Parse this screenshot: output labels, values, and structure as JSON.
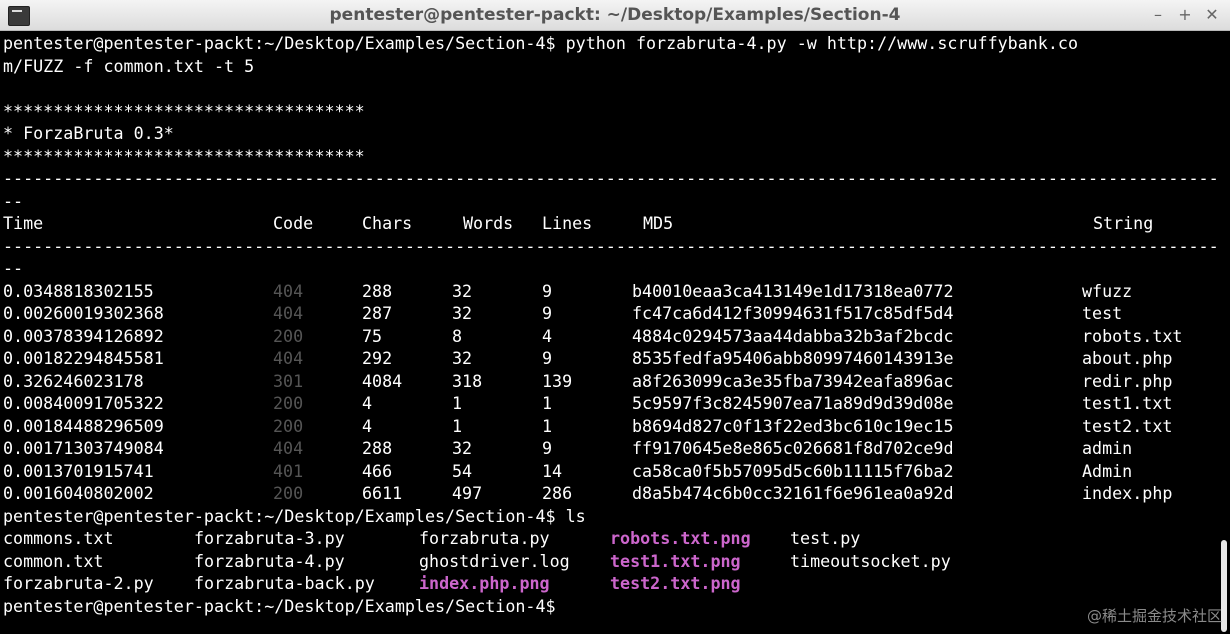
{
  "window": {
    "title": "pentester@pentester-packt: ~/Desktop/Examples/Section-4"
  },
  "terminal": {
    "command_lines": [
      "pentester@pentester-packt:~/Desktop/Examples/Section-4$ python forzabruta-4.py -w http://www.scruffybank.co",
      "m/FUZZ -f common.txt -t 5"
    ],
    "banner": [
      "************************************",
      "* ForzaBruta 0.3*",
      "************************************"
    ],
    "separator": "----------------------------------------------------------------------------------------------------------------------------------------------",
    "separator_wrap": "--",
    "headers": {
      "time": "Time",
      "code": "Code",
      "chars": "Chars",
      "words": "Words",
      "lines": "Lines",
      "md5": "MD5",
      "string": "String"
    },
    "rows": [
      {
        "time": "0.0348818302155",
        "code": "404",
        "chars": "288",
        "words": "32",
        "lines": "9",
        "md5": "b40010eaa3ca413149e1d17318ea0772",
        "string": "wfuzz"
      },
      {
        "time": "0.00260019302368",
        "code": "404",
        "chars": "287",
        "words": "32",
        "lines": "9",
        "md5": "fc47ca6d412f30994631f517c85df5d4",
        "string": "test"
      },
      {
        "time": "0.00378394126892",
        "code": "200",
        "chars": "75",
        "words": "8",
        "lines": "4",
        "md5": "4884c0294573aa44dabba32b3af2bcdc",
        "string": "robots.txt"
      },
      {
        "time": "0.00182294845581",
        "code": "404",
        "chars": "292",
        "words": "32",
        "lines": "9",
        "md5": "8535fedfa95406abb80997460143913e",
        "string": "about.php"
      },
      {
        "time": "0.326246023178",
        "code": "301",
        "chars": "4084",
        "words": "318",
        "lines": "139",
        "md5": "a8f263099ca3e35fba73942eafa896ac",
        "string": "redir.php"
      },
      {
        "time": "0.00840091705322",
        "code": "200",
        "chars": "4",
        "words": "1",
        "lines": "1",
        "md5": "5c9597f3c8245907ea71a89d9d39d08e",
        "string": "test1.txt"
      },
      {
        "time": "0.00184488296509",
        "code": "200",
        "chars": "4",
        "words": "1",
        "lines": "1",
        "md5": "b8694d827c0f13f22ed3bc610c19ec15",
        "string": "test2.txt"
      },
      {
        "time": "0.00171303749084",
        "code": "404",
        "chars": "288",
        "words": "32",
        "lines": "9",
        "md5": "ff9170645e8e865c026681f8d702ce9d",
        "string": "admin"
      },
      {
        "time": "0.0013701915741",
        "code": "401",
        "chars": "466",
        "words": "54",
        "lines": "14",
        "md5": "ca58ca0f5b57095d5c60b11115f76ba2",
        "string": "Admin"
      },
      {
        "time": "0.0016040802002",
        "code": "200",
        "chars": "6611",
        "words": "497",
        "lines": "286",
        "md5": "d8a5b474c6b0cc32161f6e961ea0a92d",
        "string": "index.php"
      }
    ],
    "ls_prompt": "pentester@pentester-packt:~/Desktop/Examples/Section-4$ ls",
    "ls_rows": [
      [
        "commons.txt",
        "forzabruta-3.py",
        "forzabruta.py",
        "robots.txt.png",
        "test.py"
      ],
      [
        "common.txt",
        "forzabruta-4.py",
        "ghostdriver.log",
        "test1.txt.png",
        "timeoutsocket.py"
      ],
      [
        "forzabruta-2.py",
        "forzabruta-back.py",
        "index.php.png",
        "test2.txt.png",
        ""
      ]
    ],
    "final_prompt": "pentester@pentester-packt:~/Desktop/Examples/Section-4$"
  },
  "watermark": "@稀土掘金技术社区",
  "colors": {
    "background": "#000000",
    "text": "#ffffff",
    "status_code": "#555555",
    "png_file": "#cc66cc"
  }
}
